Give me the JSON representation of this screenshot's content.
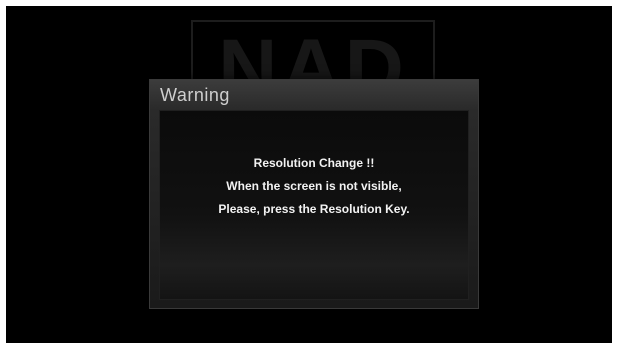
{
  "background_logo": {
    "text": "NAD"
  },
  "dialog": {
    "title": "Warning",
    "lines": [
      "Resolution Change !!",
      "When the screen is not visible,",
      "Please, press the Resolution Key."
    ]
  },
  "colors": {
    "screen_background": "#000000",
    "dialog_frame": "#2a2a2a",
    "text": "#f2f2f2",
    "title_text": "#cfcfcf"
  }
}
